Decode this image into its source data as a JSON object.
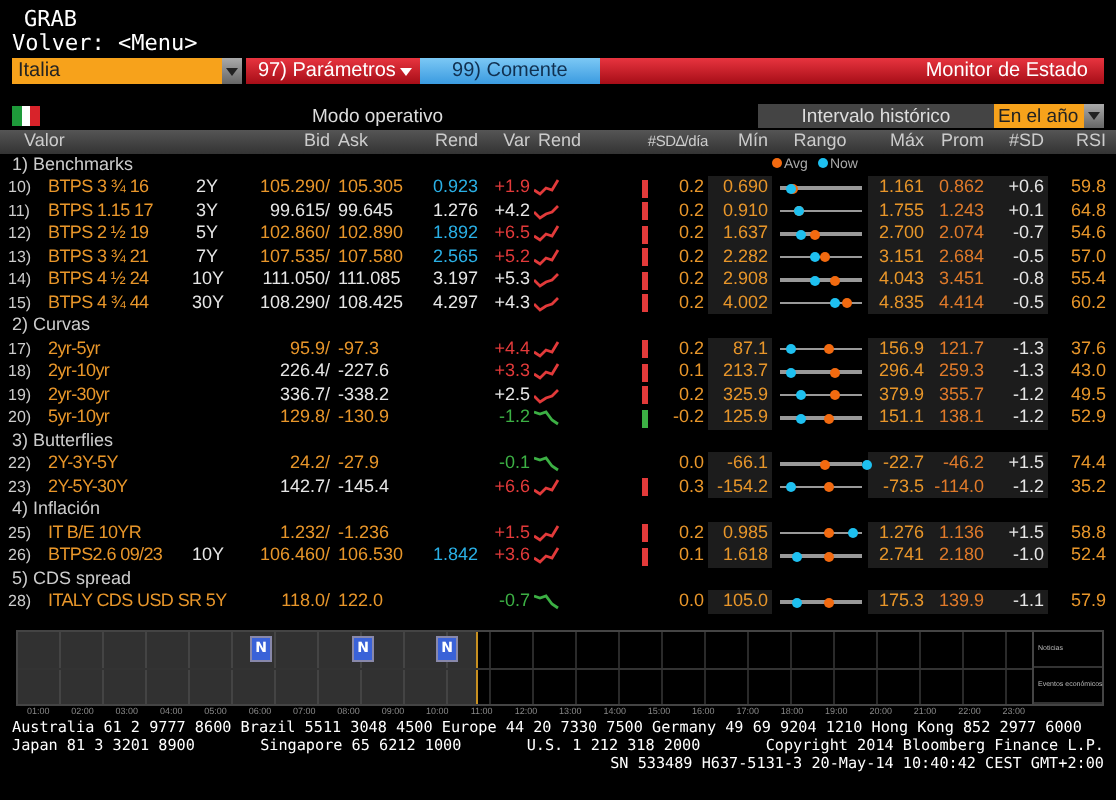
{
  "header": {
    "title": "GRAB",
    "back": "Volver: <Menu>"
  },
  "toolbar": {
    "country": "Italia",
    "params": "97) Parámetros",
    "comment": "99) Comente",
    "screen_title": "Monitor de Estado"
  },
  "subbar": {
    "mode": "Modo operativo",
    "interval": "Intervalo histórico",
    "period": "En el año"
  },
  "table": {
    "columns": [
      "Valor",
      "Bid",
      "Ask",
      "Rend",
      "Var",
      "Rend",
      "#SD∆/día",
      "Mín",
      "Rango",
      "Máx",
      "Prom",
      "#SD",
      "RSI"
    ],
    "range_legend": [
      "Avg",
      "Now"
    ],
    "sections": [
      {
        "num": "1)",
        "title": "Benchmarks",
        "rows": [
          {
            "num": "10)",
            "name": "BTPS 3 ¾ 16",
            "tenor": "2Y",
            "bid": "105.290/",
            "ask": "105.305",
            "bid_ask_live": true,
            "rend": "0.923",
            "rend_live": true,
            "var": "+1.9",
            "var_up": true,
            "var_down": false,
            "sd_bar": true,
            "sd_up": true,
            "sd_day": "0.2",
            "min": "0.690",
            "range": {
              "avg": {
                "level": 0.22
              },
              "now": {
                "level": 0.2
              }
            },
            "max": "1.161",
            "prom": "0.862",
            "sd": "+0.6",
            "rsi": "59.8"
          },
          {
            "num": "11)",
            "name": "BTPS 1.15 17",
            "tenor": "3Y",
            "bid": "99.615/",
            "ask": "99.645",
            "bid_ask_live": false,
            "rend": "1.276",
            "rend_live": false,
            "var": "+4.2",
            "var_up": false,
            "var_down": false,
            "sd_bar": true,
            "sd_up": true,
            "sd_day": "0.2",
            "min": "0.910",
            "range": {
              "avg": {
                "level": 0.28
              },
              "now": {
                "level": 0.28
              }
            },
            "max": "1.755",
            "prom": "1.243",
            "sd": "+0.1",
            "rsi": "64.8"
          },
          {
            "num": "12)",
            "name": "BTPS 2 ½ 19",
            "tenor": "5Y",
            "bid": "102.860/",
            "ask": "102.890",
            "bid_ask_live": true,
            "rend": "1.892",
            "rend_live": true,
            "var": "+6.5",
            "var_up": true,
            "var_down": false,
            "sd_bar": true,
            "sd_up": true,
            "sd_day": "0.2",
            "min": "1.637",
            "range": {
              "avg": {
                "level": 0.45
              },
              "now": {
                "level": 0.3
              }
            },
            "max": "2.700",
            "prom": "2.074",
            "sd": "-0.7",
            "rsi": "54.6"
          },
          {
            "num": "13)",
            "name": "BTPS 3 ¾ 21",
            "tenor": "7Y",
            "bid": "107.535/",
            "ask": "107.580",
            "bid_ask_live": true,
            "rend": "2.565",
            "rend_live": true,
            "var": "+5.2",
            "var_up": true,
            "var_down": false,
            "sd_bar": true,
            "sd_up": true,
            "sd_day": "0.2",
            "min": "2.282",
            "range": {
              "avg": {
                "level": 0.55
              },
              "now": {
                "level": 0.45
              }
            },
            "max": "3.151",
            "prom": "2.684",
            "sd": "-0.5",
            "rsi": "57.0"
          },
          {
            "num": "14)",
            "name": "BTPS 4 ½ 24",
            "tenor": "10Y",
            "bid": "111.050/",
            "ask": "111.085",
            "bid_ask_live": false,
            "rend": "3.197",
            "rend_live": false,
            "var": "+5.3",
            "var_up": false,
            "var_down": false,
            "sd_bar": true,
            "sd_up": true,
            "sd_day": "0.2",
            "min": "2.908",
            "range": {
              "avg": {
                "level": 0.65
              },
              "now": {
                "level": 0.45
              }
            },
            "max": "4.043",
            "prom": "3.451",
            "sd": "-0.8",
            "rsi": "55.4"
          },
          {
            "num": "15)",
            "name": "BTPS 4 ¾ 44",
            "tenor": "30Y",
            "bid": "108.290/",
            "ask": "108.425",
            "bid_ask_live": false,
            "rend": "4.297",
            "rend_live": false,
            "var": "+4.3",
            "var_up": false,
            "var_down": false,
            "sd_bar": true,
            "sd_up": true,
            "sd_day": "0.2",
            "min": "4.002",
            "range": {
              "avg": {
                "level": 0.78
              },
              "now": {
                "level": 0.65
              }
            },
            "max": "4.835",
            "prom": "4.414",
            "sd": "-0.5",
            "rsi": "60.2"
          }
        ]
      },
      {
        "num": "2)",
        "title": "Curvas",
        "rows": [
          {
            "num": "17)",
            "name": "2yr-5yr",
            "bid": "95.9/",
            "ask": "-97.3",
            "bid_ask_live": true,
            "var": "+4.4",
            "var_up": true,
            "var_down": false,
            "sd_bar": true,
            "sd_up": true,
            "sd_day": "0.2",
            "min": "87.1",
            "range": {
              "avg": {
                "level": 0.6
              },
              "now": {
                "level": 0.2
              }
            },
            "max": "156.9",
            "prom": "121.7",
            "sd": "-1.3",
            "rsi": "37.6"
          },
          {
            "num": "18)",
            "name": "2yr-10yr",
            "bid": "226.4/",
            "ask": "-227.6",
            "bid_ask_live": false,
            "var": "+3.3",
            "var_up": true,
            "var_down": false,
            "sd_bar": true,
            "sd_up": true,
            "sd_day": "0.1",
            "min": "213.7",
            "range": {
              "avg": {
                "level": 0.65
              },
              "now": {
                "level": 0.2
              }
            },
            "max": "296.4",
            "prom": "259.3",
            "sd": "-1.3",
            "rsi": "43.0"
          },
          {
            "num": "19)",
            "name": "2yr-30yr",
            "bid": "336.7/",
            "ask": "-338.2",
            "bid_ask_live": false,
            "var": "+2.5",
            "var_up": false,
            "var_down": false,
            "sd_bar": true,
            "sd_up": true,
            "sd_day": "0.2",
            "min": "325.9",
            "range": {
              "avg": {
                "level": 0.65
              },
              "now": {
                "level": 0.3
              }
            },
            "max": "379.9",
            "prom": "355.7",
            "sd": "-1.2",
            "rsi": "49.5"
          },
          {
            "num": "20)",
            "name": "5yr-10yr",
            "bid": "129.8/",
            "ask": "-130.9",
            "bid_ask_live": true,
            "var": "-1.2",
            "var_up": false,
            "var_down": true,
            "sd_bar": true,
            "sd_up": false,
            "sd_day": "-0.2",
            "min": "125.9",
            "range": {
              "avg": {
                "level": 0.6
              },
              "now": {
                "level": 0.3
              }
            },
            "max": "151.1",
            "prom": "138.1",
            "sd": "-1.2",
            "rsi": "52.9"
          }
        ]
      },
      {
        "num": "3)",
        "title": "Butterflies",
        "rows": [
          {
            "num": "22)",
            "name": "2Y-3Y-5Y",
            "bid": "24.2/",
            "ask": "-27.9",
            "bid_ask_live": true,
            "var": "-0.1",
            "var_up": false,
            "var_down": true,
            "sd_bar": false,
            "sd_day": "0.0",
            "min": "-66.1",
            "range": {
              "avg": {
                "level": 0.55
              },
              "now": {
                "level": 0.98
              }
            },
            "max": "-22.7",
            "prom": "-46.2",
            "sd": "+1.5",
            "rsi": "74.4"
          },
          {
            "num": "23)",
            "name": "2Y-5Y-30Y",
            "bid": "142.7/",
            "ask": "-145.4",
            "bid_ask_live": false,
            "var": "+6.6",
            "var_up": true,
            "var_down": false,
            "sd_bar": true,
            "sd_up": true,
            "sd_day": "0.3",
            "min": "-154.2",
            "range": {
              "avg": {
                "level": 0.6
              },
              "now": {
                "level": 0.2
              }
            },
            "max": "-73.5",
            "prom": "-114.0",
            "sd": "-1.2",
            "rsi": "35.2"
          }
        ]
      },
      {
        "num": "4)",
        "title": "Inflación",
        "rows": [
          {
            "num": "25)",
            "name": "IT B/E 10YR",
            "bid": "1.232/",
            "ask": "-1.236",
            "bid_ask_live": true,
            "var": "+1.5",
            "var_up": true,
            "var_down": false,
            "sd_bar": true,
            "sd_up": true,
            "sd_day": "0.2",
            "min": "0.985",
            "range": {
              "avg": {
                "level": 0.6
              },
              "now": {
                "level": 0.85
              }
            },
            "max": "1.276",
            "prom": "1.136",
            "sd": "+1.5",
            "rsi": "58.8"
          },
          {
            "num": "26)",
            "name": "BTPS2.6 09/23",
            "tenor": "10Y",
            "bid": "106.460/",
            "ask": "106.530",
            "bid_ask_live": true,
            "rend": "1.842",
            "rend_live": true,
            "var": "+3.6",
            "var_up": true,
            "var_down": false,
            "sd_bar": true,
            "sd_up": true,
            "sd_day": "0.1",
            "min": "1.618",
            "range": {
              "avg": {
                "level": 0.6
              },
              "now": {
                "level": 0.25
              }
            },
            "max": "2.741",
            "prom": "2.180",
            "sd": "-1.0",
            "rsi": "52.4"
          }
        ]
      },
      {
        "num": "5)",
        "title": "CDS spread",
        "rows": [
          {
            "num": "28)",
            "name": "ITALY CDS USD SR 5Y",
            "bid": "118.0/",
            "ask": "122.0",
            "bid_ask_live": true,
            "var": "-0.7",
            "var_up": false,
            "var_down": true,
            "sd_bar": false,
            "sd_day": "0.0",
            "min": "105.0",
            "range": {
              "avg": {
                "level": 0.6
              },
              "now": {
                "level": 0.25
              }
            },
            "max": "175.3",
            "prom": "139.9",
            "sd": "-1.1",
            "rsi": "57.9"
          }
        ]
      }
    ]
  },
  "timeline": {
    "elapsed": {
      "level": 0.451
    },
    "markers": [
      {
        "label": "N"
      },
      {
        "label": "N"
      },
      {
        "label": "N"
      }
    ],
    "lanes": [
      "Noticias",
      "Eventos económicos"
    ],
    "hours": [
      "01:00",
      "02:00",
      "03:00",
      "04:00",
      "05:00",
      "06:00",
      "07:00",
      "08:00",
      "09:00",
      "10:00",
      "11:00",
      "12:00",
      "13:00",
      "14:00",
      "15:00",
      "16:00",
      "17:00",
      "18:00",
      "19:00",
      "20:00",
      "21:00",
      "22:00",
      "23:00"
    ]
  },
  "footer": {
    "contacts": "Australia 61 2 9777 8600 Brazil 5511 3048 4500 Europe 44 20 7330 7500 Germany 49 69 9204 1210 Hong Kong 852 2977 6000",
    "offices": [
      "Japan 81 3 3201 8900",
      "Singapore 65 6212 1000",
      "U.S. 1 212 318 2000",
      "Copyright 2014 Bloomberg Finance L.P."
    ],
    "session": "SN 533489 H637-5131-3 20-May-14 10:40:42 CEST GMT+2:00"
  }
}
